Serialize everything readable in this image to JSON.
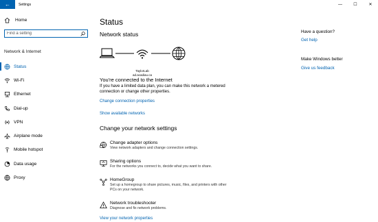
{
  "window": {
    "title": "Settings",
    "controls": {
      "minimize": "—",
      "maximize": "☐",
      "close": "✕"
    },
    "back_icon": "←"
  },
  "sidebar": {
    "home_label": "Home",
    "search_placeholder": "Find a setting",
    "section_label": "Network & Internet",
    "items": [
      {
        "label": "Status",
        "icon": "status-globe-icon",
        "active": true
      },
      {
        "label": "Wi-Fi",
        "icon": "wifi-icon"
      },
      {
        "label": "Ethernet",
        "icon": "ethernet-icon"
      },
      {
        "label": "Dial-up",
        "icon": "phone-icon"
      },
      {
        "label": "VPN",
        "icon": "vpn-icon"
      },
      {
        "label": "Airplane mode",
        "icon": "airplane-icon"
      },
      {
        "label": "Mobile hotspot",
        "icon": "hotspot-icon"
      },
      {
        "label": "Data usage",
        "icon": "data-usage-icon"
      },
      {
        "label": "Proxy",
        "icon": "globe-icon"
      }
    ]
  },
  "main": {
    "title": "Status",
    "network_status_heading": "Network status",
    "network_name_line1": "TaylorLab",
    "network_name_line2": "ad.acadiau.ca",
    "connected_text": "You're connected to the Internet",
    "connected_desc": "If you have a limited data plan, you can make this network a metered connection or change other properties.",
    "change_connection_link": "Change connection properties",
    "show_networks_link": "Show available networks",
    "change_settings_heading": "Change your network settings",
    "settings": [
      {
        "title": "Change adapter options",
        "desc": "View network adapters and change connection settings.",
        "icon": "adapter-icon"
      },
      {
        "title": "Sharing options",
        "desc": "For the networks you connect to, decide what you want to share.",
        "icon": "sharing-icon"
      },
      {
        "title": "HomeGroup",
        "desc": "Set up a homegroup to share pictures, music, files, and printers with other PCs on your network.",
        "icon": "homegroup-icon"
      },
      {
        "title": "Network troubleshooter",
        "desc": "Diagnose and fix network problems.",
        "icon": "warning-icon"
      }
    ],
    "view_properties_link": "View your network properties"
  },
  "right_panel": {
    "question_heading": "Have a question?",
    "get_help_link": "Get help",
    "better_heading": "Make Windows better",
    "feedback_link": "Give us feedback"
  },
  "colors": {
    "accent": "#0063b1"
  }
}
